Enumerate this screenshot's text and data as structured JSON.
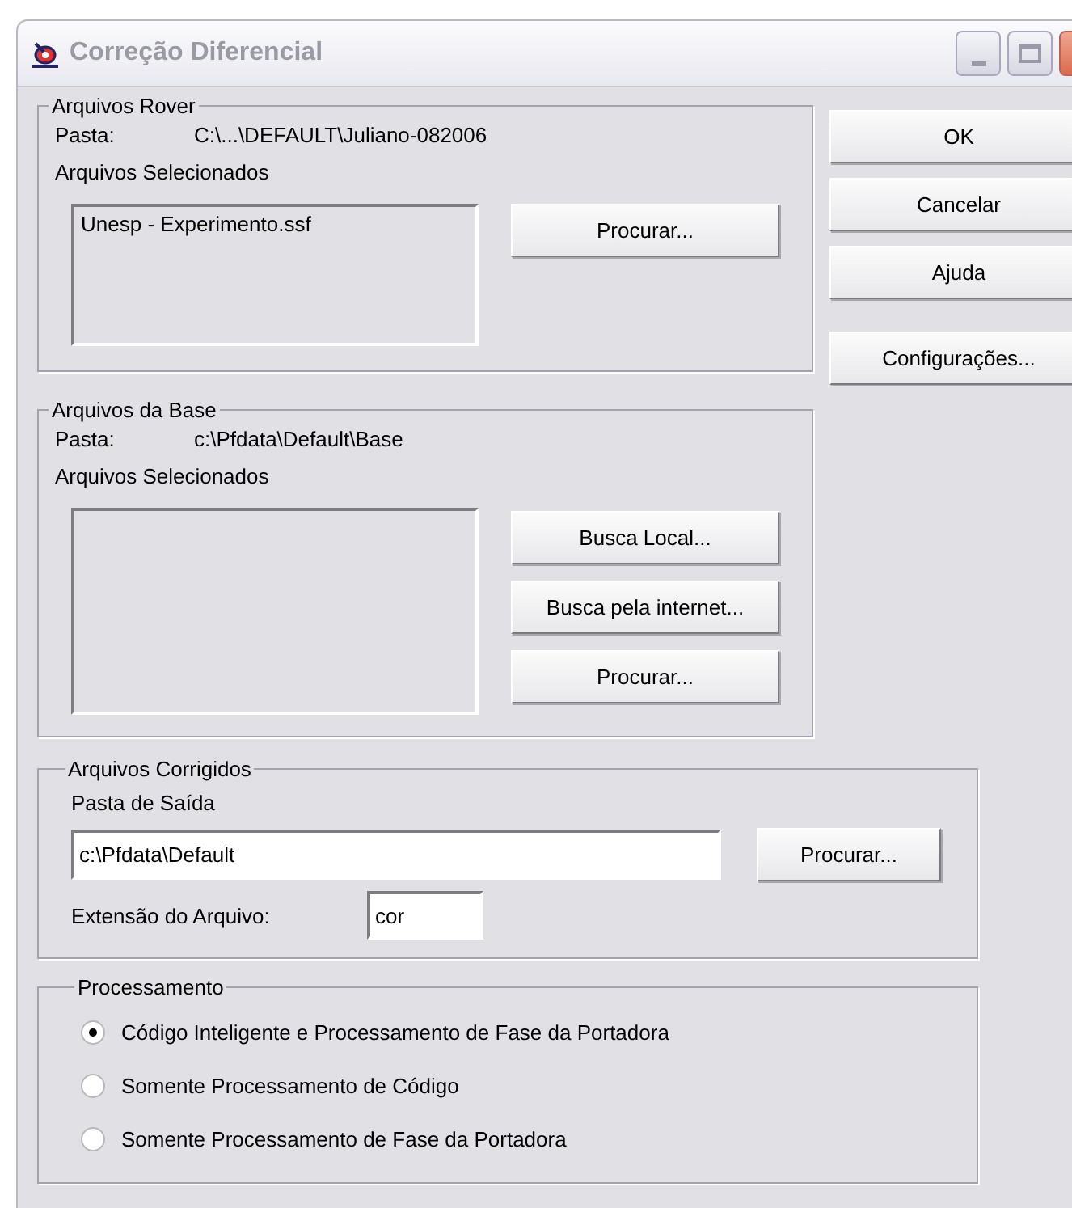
{
  "window": {
    "title": "Correção Diferencial"
  },
  "rover": {
    "legend": "Arquivos Rover",
    "folder_label": "Pasta:",
    "folder_path": "C:\\...\\DEFAULT\\Juliano-082006",
    "selected_label": "Arquivos Selecionados",
    "files": [
      "Unesp - Experimento.ssf"
    ],
    "buttons": [
      "Procurar..."
    ]
  },
  "side_buttons": [
    "OK",
    "Cancelar",
    "Ajuda",
    "Configurações..."
  ],
  "base": {
    "legend": "Arquivos da Base",
    "folder_label": "Pasta:",
    "folder_path": "c:\\Pfdata\\Default\\Base",
    "selected_label": "Arquivos Selecionados",
    "buttons": [
      "Busca Local...",
      "Busca pela internet...",
      "Procurar..."
    ]
  },
  "corrected": {
    "legend": "Arquivos Corrigidos",
    "output_label": "Pasta de Saída",
    "output_value": "c:\\Pfdata\\Default",
    "browse_button": "Procurar...",
    "extension_label": "Extensão do Arquivo:",
    "extension_value": "cor"
  },
  "processing": {
    "legend": "Processamento",
    "options": [
      {
        "label": "Código Inteligente e Processamento de Fase da Portadora",
        "selected": true
      },
      {
        "label": "Somente Processamento de Código",
        "selected": false
      },
      {
        "label": "Somente Processamento de Fase da Portadora",
        "selected": false
      }
    ]
  }
}
